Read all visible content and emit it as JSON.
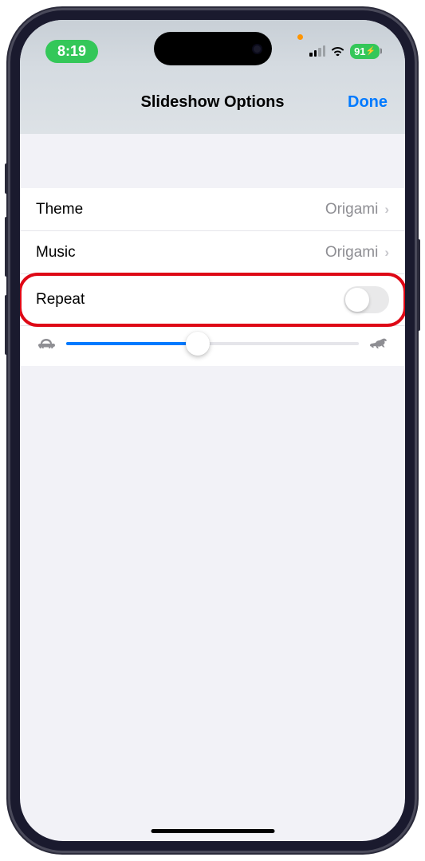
{
  "status_bar": {
    "time": "8:19",
    "battery": "91",
    "signal_bars": 2,
    "wifi": true
  },
  "header": {
    "title": "Slideshow Options",
    "done_label": "Done"
  },
  "settings": {
    "theme": {
      "label": "Theme",
      "value": "Origami"
    },
    "music": {
      "label": "Music",
      "value": "Origami"
    },
    "repeat": {
      "label": "Repeat",
      "enabled": false
    },
    "speed": {
      "value_percent": 45,
      "slow_icon": "tortoise",
      "fast_icon": "hare"
    }
  },
  "annotation": {
    "highlight_color": "#de0816",
    "highlighted_row": "repeat"
  }
}
